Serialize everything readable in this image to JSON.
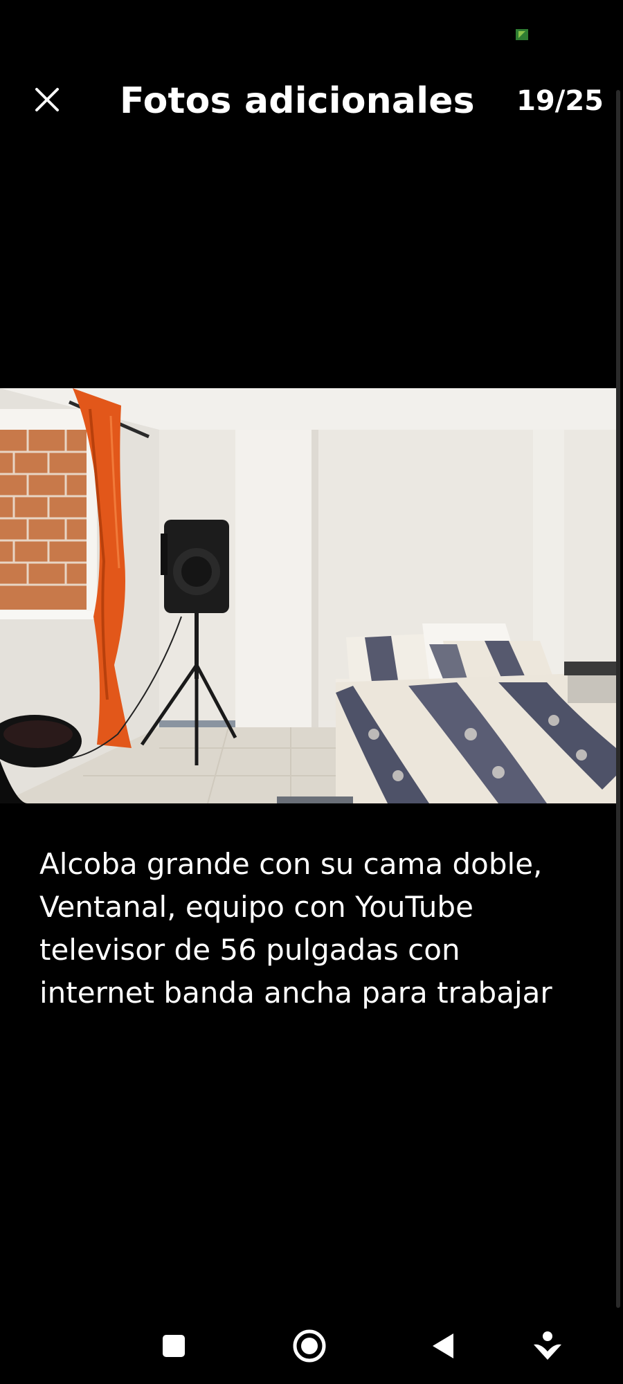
{
  "header": {
    "close_icon": "close-icon",
    "title": "Fotos adicionales",
    "counter": "19/25"
  },
  "photo": {
    "description_icon": "photo-bedroom"
  },
  "caption": {
    "text": "Alcoba grande con su cama doble,\nVentanal, equipo con YouTube\ntelevisor de 56 pulgadas con\ninternet banda ancha para trabajar"
  },
  "status_bar": {
    "indicator_color": "#4caf50"
  },
  "nav_bar": {
    "icons": [
      "recents-square-icon",
      "home-circle-icon",
      "back-triangle-icon",
      "assist-icon"
    ]
  }
}
